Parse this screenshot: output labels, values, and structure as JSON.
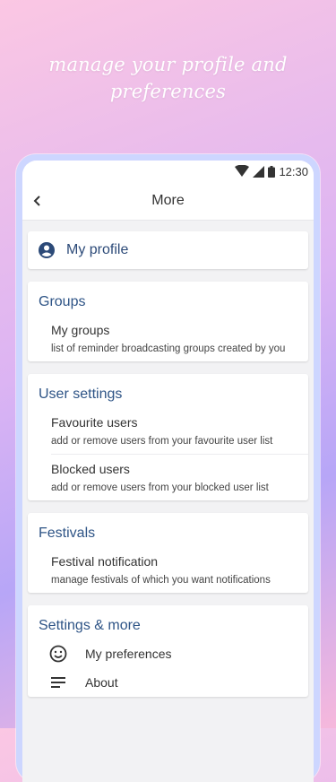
{
  "tagline": "manage your profile and preferences",
  "status": {
    "time": "12:30"
  },
  "appbar": {
    "title": "More"
  },
  "profile": {
    "label": "My profile"
  },
  "groups": {
    "title": "Groups",
    "items": [
      {
        "title": "My groups",
        "subtitle": "list of reminder broadcasting groups created by you"
      }
    ]
  },
  "user_settings": {
    "title": "User settings",
    "items": [
      {
        "title": "Favourite users",
        "subtitle": "add or remove users from your favourite user list"
      },
      {
        "title": "Blocked users",
        "subtitle": "add or remove users from your blocked user list"
      }
    ]
  },
  "festivals": {
    "title": "Festivals",
    "items": [
      {
        "title": "Festival notification",
        "subtitle": "manage festivals of which you want notifications"
      }
    ]
  },
  "settings_more": {
    "title": "Settings & more",
    "items": [
      {
        "label": "My preferences",
        "icon": "smiley-icon"
      },
      {
        "label": "About",
        "icon": "notes-icon"
      }
    ]
  },
  "colors": {
    "accent": "#2e5486",
    "frame": "#cdd6ff"
  }
}
